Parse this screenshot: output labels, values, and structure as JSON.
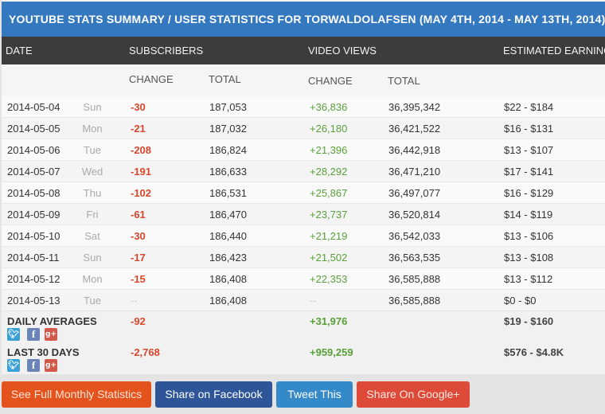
{
  "title": "YOUTUBE STATS SUMMARY / USER STATISTICS FOR TORWALDOLAFSEN (MAY 4TH, 2014 - MAY 13TH, 2014)",
  "headers": {
    "date": "DATE",
    "subscribers": "SUBSCRIBERS",
    "video_views": "VIDEO VIEWS",
    "estimated_earnings": "ESTIMATED EARNINGS"
  },
  "subheaders": {
    "sub_change": "CHANGE",
    "sub_total": "TOTAL",
    "views_change": "CHANGE",
    "views_total": "TOTAL"
  },
  "rows": [
    {
      "date": "2014-05-04",
      "day": "Sun",
      "sub_change": "-30",
      "sub_total": "187,053",
      "views_change": "+36,836",
      "views_total": "36,395,342",
      "earnings": "$22  -  $184"
    },
    {
      "date": "2014-05-05",
      "day": "Mon",
      "sub_change": "-21",
      "sub_total": "187,032",
      "views_change": "+26,180",
      "views_total": "36,421,522",
      "earnings": "$16  -  $131"
    },
    {
      "date": "2014-05-06",
      "day": "Tue",
      "sub_change": "-208",
      "sub_total": "186,824",
      "views_change": "+21,396",
      "views_total": "36,442,918",
      "earnings": "$13  -  $107"
    },
    {
      "date": "2014-05-07",
      "day": "Wed",
      "sub_change": "-191",
      "sub_total": "186,633",
      "views_change": "+28,292",
      "views_total": "36,471,210",
      "earnings": "$17  -  $141"
    },
    {
      "date": "2014-05-08",
      "day": "Thu",
      "sub_change": "-102",
      "sub_total": "186,531",
      "views_change": "+25,867",
      "views_total": "36,497,077",
      "earnings": "$16  -  $129"
    },
    {
      "date": "2014-05-09",
      "day": "Fri",
      "sub_change": "-61",
      "sub_total": "186,470",
      "views_change": "+23,737",
      "views_total": "36,520,814",
      "earnings": "$14  -  $119"
    },
    {
      "date": "2014-05-10",
      "day": "Sat",
      "sub_change": "-30",
      "sub_total": "186,440",
      "views_change": "+21,219",
      "views_total": "36,542,033",
      "earnings": "$13  -  $106"
    },
    {
      "date": "2014-05-11",
      "day": "Sun",
      "sub_change": "-17",
      "sub_total": "186,423",
      "views_change": "+21,502",
      "views_total": "36,563,535",
      "earnings": "$13  -  $108"
    },
    {
      "date": "2014-05-12",
      "day": "Mon",
      "sub_change": "-15",
      "sub_total": "186,408",
      "views_change": "+22,353",
      "views_total": "36,585,888",
      "earnings": "$13  -  $112"
    },
    {
      "date": "2014-05-13",
      "day": "Tue",
      "sub_change": "--",
      "sub_total": "186,408",
      "views_change": "--",
      "views_total": "36,585,888",
      "earnings": "$0  -  $0"
    }
  ],
  "summary": {
    "daily_averages": {
      "label": "DAILY AVERAGES",
      "sub_change": "-92",
      "views_change": "+31,976",
      "earnings": "$19  -  $160"
    },
    "last_30_days": {
      "label": "LAST 30 DAYS",
      "sub_change": "-2,768",
      "views_change": "+959,259",
      "earnings": "$576  -  $4.8K"
    }
  },
  "share_icons": {
    "twitter": "twitter-icon",
    "facebook": "facebook-icon",
    "google_plus": "google-plus-icon"
  },
  "buttons": {
    "monthly": "See Full Monthly Statistics",
    "facebook": "Share on Facebook",
    "tweet": "Tweet This",
    "google": "Share On Google+"
  },
  "colors": {
    "title_bar": "#3478c0",
    "header_bar": "#3c3c3c",
    "negative": "#d9472b",
    "positive": "#5aa03a"
  }
}
